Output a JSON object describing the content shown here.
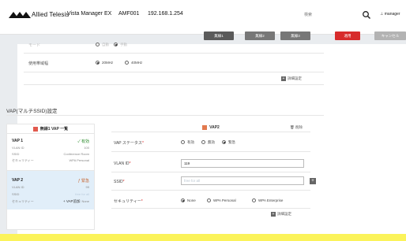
{
  "header": {
    "brand": "Allied Telesis",
    "product": "Vista Manager EX",
    "device": "AMF001",
    "ip": "192.168.1.254",
    "search_placeholder": "検索",
    "user": "manager"
  },
  "toolbar": {
    "tab1": "無線1",
    "tab2": "無線2",
    "tab3": "無線3",
    "apply": "適用",
    "cancel": "キャンセル"
  },
  "radio_settings": {
    "mode_label": "モード",
    "mode_opt1": "自動",
    "mode_opt2": "手動",
    "bandwidth_label": "使用帯域幅",
    "bw_opt1": "20MHz",
    "bw_opt2": "40MHz",
    "detail_label": "詳細設定"
  },
  "vap_section": {
    "title": "VAP(マルチSSID)設定",
    "list_header": "無線1 VAP 一覧",
    "add_label": "+ VAP追加"
  },
  "vap_list": [
    {
      "name": "VAP 1",
      "status": "✓ 有効",
      "rows": [
        {
          "k": "VLAN ID",
          "v": "100"
        },
        {
          "k": "SSID",
          "v": "Conference Room"
        },
        {
          "k": "セキュリティー",
          "v": "WPA Personal"
        }
      ]
    },
    {
      "name": "VAP 2",
      "status": "ƒ 緊急",
      "rows": [
        {
          "k": "VLAN ID",
          "v": "99"
        },
        {
          "k": "SSID",
          "v": "free for all"
        },
        {
          "k": "セキュリティー",
          "v": "None"
        }
      ]
    }
  ],
  "vap_form": {
    "title": "VAP2",
    "delete": "削除",
    "status_label": "VAP ステータス",
    "status_opts": [
      "有効",
      "無効",
      "緊急"
    ],
    "vlan_label": "VLAN ID",
    "vlan_value": "119",
    "ssid_label": "SSID",
    "ssid_value": "free for all",
    "security_label": "セキュリティー",
    "security_opts": [
      "None",
      "WPA Personal",
      "WPA Enterprise"
    ],
    "detail_label": "詳細設定"
  },
  "colors": {
    "accent_red": "#d72b2b",
    "selected_bg": "#e1eef9",
    "banner_yellow": "#fbf35a"
  }
}
